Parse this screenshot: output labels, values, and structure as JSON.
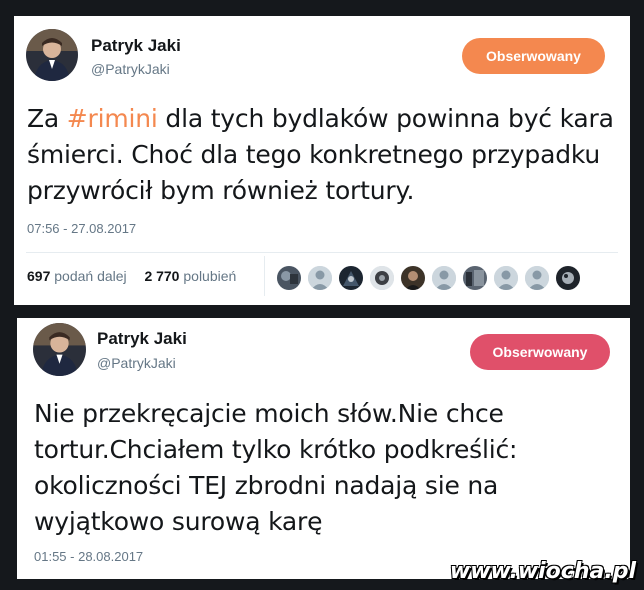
{
  "tweets": [
    {
      "author_name": "Patryk Jaki",
      "author_handle": "@PatrykJaki",
      "follow_label": "Obserwowany",
      "text_before": "Za ",
      "hashtag": "#rimini",
      "text_after": " dla tych bydlaków powinna być kara śmierci. Choć dla tego konkretnego przypadku przywrócił bym również tortury.",
      "timestamp": "07:56 - 27.08.2017",
      "retweets_count": "697",
      "retweets_label": "podań dalej",
      "likes_count": "2 770",
      "likes_label": "polubień",
      "likers": [
        "avatar",
        "default-avatar",
        "avatar",
        "avatar",
        "avatar",
        "default-avatar",
        "avatar",
        "default-avatar",
        "default-avatar",
        "avatar"
      ]
    },
    {
      "author_name": "Patryk Jaki",
      "author_handle": "@PatrykJaki",
      "follow_label": "Obserwowany",
      "text": "Nie przekręcajcie moich słów.Nie chce tortur.Chciałem tylko krótko podkreślić: okoliczności TEJ zbrodni nadają sie na wyjątkowo surową karę",
      "timestamp": "01:55 - 28.08.2017"
    }
  ],
  "watermark": "www.wiocha.pl",
  "colors": {
    "follow_orange": "#f4884f",
    "follow_pink": "#e0506a",
    "hashtag": "#f4884f",
    "background": "#15181c"
  }
}
